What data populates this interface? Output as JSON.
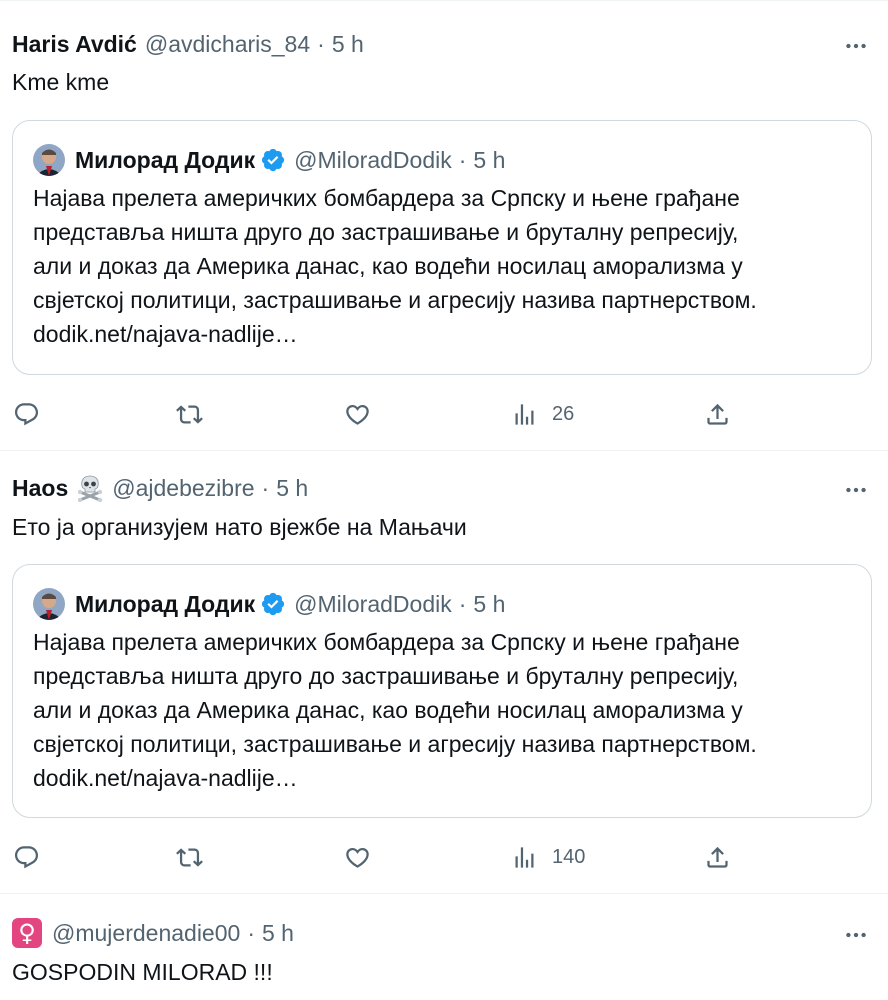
{
  "tweets": [
    {
      "display_name": "Haris Avdić",
      "handle": "@avdicharis_84",
      "separator": "·",
      "time": "5 h",
      "text": "Kme kme",
      "quote": {
        "display_name": "Милорад Додик",
        "handle": "@MiloradDodik",
        "separator": "·",
        "time": "5 h",
        "lines": [
          "Најава прелета америчких бомбардера за Српску и њене грађане",
          "представља ништа друго до застрашивање и бруталну репресију,",
          "али и доказ да Америка данас, као водећи носилац аморализма у",
          "свјетској политици, застрашивање и агресију назива партнерством.",
          "dodik.net/najava-nadlije…"
        ]
      },
      "views": "26"
    },
    {
      "display_name": "Haos",
      "name_emoji": "skull-and-crossbones-icon",
      "handle": "@ajdebezibre",
      "separator": "·",
      "time": "5 h",
      "text": "Ето ја организујем нато вјежбе на Мањачи",
      "quote": {
        "display_name": "Милорад Додик",
        "handle": "@MiloradDodik",
        "separator": "·",
        "time": "5 h",
        "lines": [
          "Најава прелета америчких бомбардера за Српску и њене грађане",
          "представља ништа друго до застрашивање и бруталну репресију,",
          "али и доказ да Америка данас, као водећи носилац аморализма у",
          "свјетској политици, застрашивање и агресију назива партнерством.",
          "dodik.net/najava-nadlije…"
        ]
      },
      "views": "140"
    },
    {
      "name_badge": "♀",
      "handle": "@mujerdenadie00",
      "separator": "·",
      "time": "5 h",
      "text": "GOSPODIN MILORAD !!!"
    }
  ],
  "colors": {
    "text_primary": "#0f1419",
    "text_secondary": "#536471",
    "border": "#cfd9de",
    "divider": "#eff3f4",
    "verified": "#1d9bf0",
    "female_badge": "#e2457f"
  }
}
